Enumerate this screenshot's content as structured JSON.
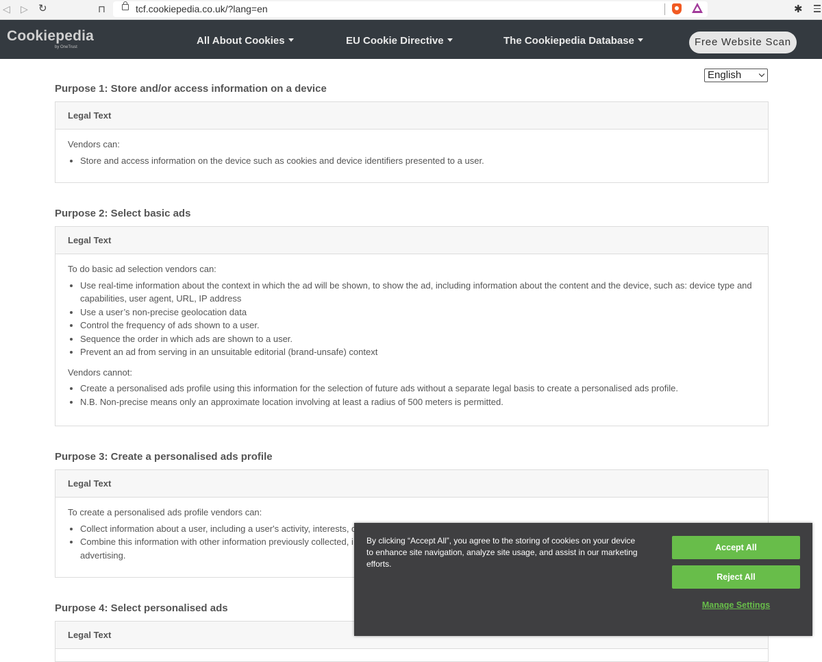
{
  "browser": {
    "url": "tcf.cookiepedia.co.uk/?lang=en",
    "icons": [
      "back-icon",
      "forward-icon",
      "reload-icon",
      "bookmark-icon",
      "lock-icon",
      "brave-shield-icon",
      "brave-rewards-icon",
      "extensions-icon",
      "menu-icon"
    ]
  },
  "navbar": {
    "logo": "Cookiepedia",
    "logo_sub": "by OneTrust",
    "items": [
      {
        "label": "All About Cookies"
      },
      {
        "label": "EU Cookie Directive"
      },
      {
        "label": "The Cookiepedia Database"
      }
    ],
    "scan_button": "Free Website Scan"
  },
  "language": {
    "selected": "English"
  },
  "purposes": [
    {
      "title": "Purpose 1: Store and/or access information on a device",
      "card_header": "Legal Text",
      "intro": "Vendors can:",
      "items": [
        "Store and access information on the device such as cookies and device identifiers presented to a user."
      ]
    },
    {
      "title": "Purpose 2: Select basic ads",
      "card_header": "Legal Text",
      "intro": "To do basic ad selection vendors can:",
      "items": [
        "Use real-time information about the context in which the ad will be shown, to show the ad, including information about the content and the device, such as: device type and capabilities, user agent, URL, IP address",
        "Use a user’s non-precise geolocation data",
        "Control the frequency of ads shown to a user.",
        "Sequence the order in which ads are shown to a user.",
        "Prevent an ad from serving in an unsuitable editorial (brand-unsafe) context"
      ],
      "intro2": "Vendors cannot:",
      "items2": [
        "Create a personalised ads profile using this information for the selection of future ads without a separate legal basis to create a personalised ads profile.",
        "N.B. Non-precise means only an approximate location involving at least a radius of 500 meters is permitted."
      ]
    },
    {
      "title": "Purpose 3: Create a personalised ads profile",
      "card_header": "Legal Text",
      "intro": "To create a personalised ads profile vendors can:",
      "items": [
        "Collect information about a user, including a user's activity, interests, d",
        "Combine this information with other information previously collected, i"
      ],
      "items_cont": "advertising."
    },
    {
      "title": "Purpose 4: Select personalised ads",
      "card_header": "Legal Text"
    }
  ],
  "cookie_banner": {
    "text": "By clicking “Accept All”, you agree to the storing of cookies on your device to enhance site navigation, analyze site usage, and assist in our marketing efforts.",
    "accept": "Accept All",
    "reject": "Reject All",
    "manage": "Manage Settings",
    "accent_color": "#68bd4a",
    "background_color": "#3f3f41"
  }
}
